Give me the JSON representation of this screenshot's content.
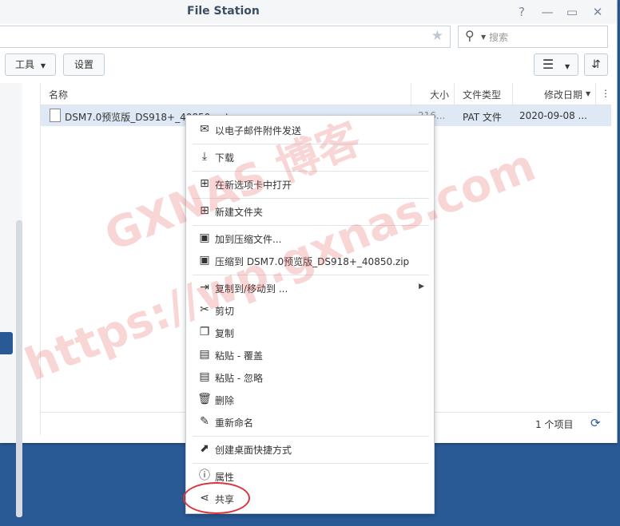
{
  "window": {
    "title": "File Station"
  },
  "search": {
    "placeholder": "搜索"
  },
  "toolbar": {
    "tools_label": "工具",
    "settings_label": "设置"
  },
  "columns": {
    "name": "名称",
    "size": "大小",
    "type": "文件类型",
    "modified": "修改日期"
  },
  "file": {
    "name": "DSM7.0预览版_DS918+_40850.pat",
    "size": "216...",
    "type": "PAT 文件",
    "modified": "2020-09-08 ..."
  },
  "status": {
    "count": "1 个项目"
  },
  "menu": {
    "email": "以电子邮件附件发送",
    "download": "下载",
    "open_new_tab": "在新选项卡中打开",
    "new_folder": "新建文件夹",
    "add_archive": "加到压缩文件...",
    "compress_to": "压缩到 DSM7.0预览版_DS918+_40850.zip",
    "copy_move_to": "复制到/移动到 ...",
    "cut": "剪切",
    "copy": "复制",
    "paste_overwrite": "粘贴 - 覆盖",
    "paste_skip": "粘贴 - 忽略",
    "delete": "删除",
    "rename": "重新命名",
    "desktop_shortcut": "创建桌面快捷方式",
    "properties": "属性",
    "share": "共享"
  },
  "watermark": {
    "line1": "GXNAS 博客",
    "line2": "https://wp.gxnas.com"
  },
  "colors": {
    "accent": "#2a5a96",
    "highlight": "#d9343a",
    "selection": "#dfe9f6"
  }
}
